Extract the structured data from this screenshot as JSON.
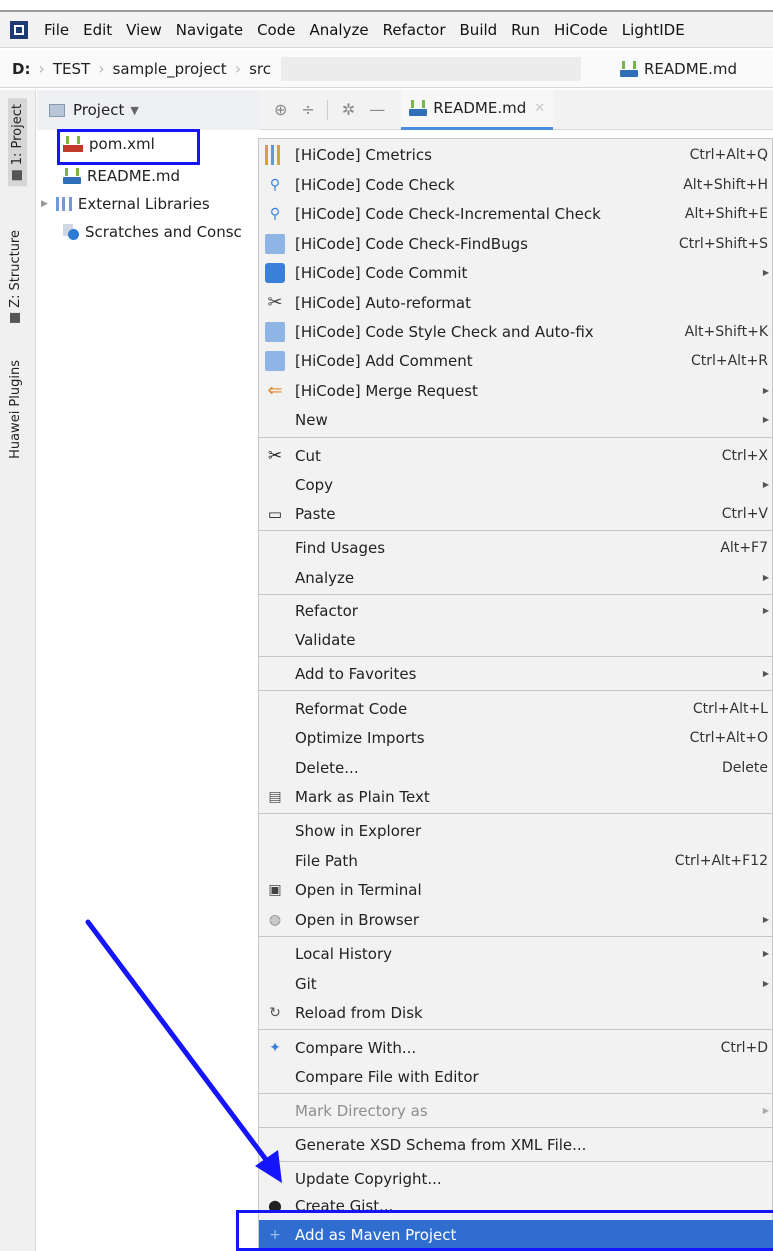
{
  "menubar": {
    "items": [
      "File",
      "Edit",
      "View",
      "Navigate",
      "Code",
      "Analyze",
      "Refactor",
      "Build",
      "Run",
      "HiCode",
      "LightIDE"
    ]
  },
  "breadcrumb": {
    "drive": "D:",
    "items": [
      "TEST",
      "sample_project",
      "src"
    ],
    "file": "README.md"
  },
  "toolstrip": {
    "project": "1: Project",
    "structure": "Z: Structure",
    "plugins": "Huawei Plugins"
  },
  "project_panel": {
    "title": "Project",
    "tree": [
      "pom.xml",
      "README.md",
      "External Libraries",
      "Scratches and Consc"
    ]
  },
  "editor": {
    "tab_label": "README.md"
  },
  "context_menu": {
    "items": [
      {
        "label": "[HiCode] Cmetrics",
        "shortcut": "Ctrl+Alt+Q",
        "icon": "cmetrics-icon"
      },
      {
        "label": "[HiCode] Code Check",
        "shortcut": "Alt+Shift+H",
        "icon": "code-check-icon"
      },
      {
        "label": "[HiCode] Code Check-Incremental Check",
        "shortcut": "Alt+Shift+E",
        "icon": "incremental-check-icon"
      },
      {
        "label": "[HiCode] Code Check-FindBugs",
        "shortcut": "Ctrl+Shift+S",
        "icon": "findbugs-icon"
      },
      {
        "label": "[HiCode] Code Commit",
        "shortcut": "",
        "icon": "code-commit-icon"
      },
      {
        "label": "[HiCode] Auto-reformat",
        "shortcut": "",
        "icon": "auto-reformat-icon"
      },
      {
        "label": "[HiCode] Code Style Check and Auto-fix",
        "shortcut": "Alt+Shift+K",
        "icon": "style-check-icon"
      },
      {
        "label": "[HiCode] Add Comment",
        "shortcut": "Ctrl+Alt+R",
        "icon": "add-comment-icon"
      },
      {
        "label": "[HiCode] Merge Request",
        "shortcut": "",
        "icon": "merge-request-icon"
      },
      {
        "label": "New",
        "shortcut": "",
        "icon": ""
      },
      {
        "label": "Cut",
        "shortcut": "Ctrl+X",
        "icon": "scissors-icon"
      },
      {
        "label": "Copy",
        "shortcut": "",
        "icon": ""
      },
      {
        "label": "Paste",
        "shortcut": "Ctrl+V",
        "icon": "paste-icon"
      },
      {
        "label": "Find Usages",
        "shortcut": "Alt+F7",
        "icon": ""
      },
      {
        "label": "Analyze",
        "shortcut": "",
        "icon": ""
      },
      {
        "label": "Refactor",
        "shortcut": "",
        "icon": ""
      },
      {
        "label": "Validate",
        "shortcut": "",
        "icon": ""
      },
      {
        "label": "Add to Favorites",
        "shortcut": "",
        "icon": ""
      },
      {
        "label": "Reformat Code",
        "shortcut": "Ctrl+Alt+L",
        "icon": ""
      },
      {
        "label": "Optimize Imports",
        "shortcut": "Ctrl+Alt+O",
        "icon": ""
      },
      {
        "label": "Delete...",
        "shortcut": "Delete",
        "icon": ""
      },
      {
        "label": "Mark as Plain Text",
        "shortcut": "",
        "icon": "plain-text-icon"
      },
      {
        "label": "Show in Explorer",
        "shortcut": "",
        "icon": ""
      },
      {
        "label": "File Path",
        "shortcut": "Ctrl+Alt+F12",
        "icon": ""
      },
      {
        "label": "Open in Terminal",
        "shortcut": "",
        "icon": "terminal-icon"
      },
      {
        "label": "Open in Browser",
        "shortcut": "",
        "icon": "browser-icon"
      },
      {
        "label": "Local History",
        "shortcut": "",
        "icon": ""
      },
      {
        "label": "Git",
        "shortcut": "",
        "icon": ""
      },
      {
        "label": "Reload from Disk",
        "shortcut": "",
        "icon": "reload-icon"
      },
      {
        "label": "Compare With...",
        "shortcut": "Ctrl+D",
        "icon": "compare-icon"
      },
      {
        "label": "Compare File with Editor",
        "shortcut": "",
        "icon": ""
      },
      {
        "label": "Mark Directory as",
        "shortcut": "",
        "icon": ""
      },
      {
        "label": "Generate XSD Schema from XML File...",
        "shortcut": "",
        "icon": ""
      },
      {
        "label": "Update Copyright...",
        "shortcut": "",
        "icon": ""
      },
      {
        "label": "Create Gist...",
        "shortcut": "",
        "icon": "github-icon"
      },
      {
        "label": "Add as Maven Project",
        "shortcut": "",
        "icon": "maven-add-icon"
      }
    ]
  },
  "colors": {
    "highlight": "#1414ff",
    "selection": "#2f6ecf",
    "menu_bg": "#f2f2f2"
  }
}
